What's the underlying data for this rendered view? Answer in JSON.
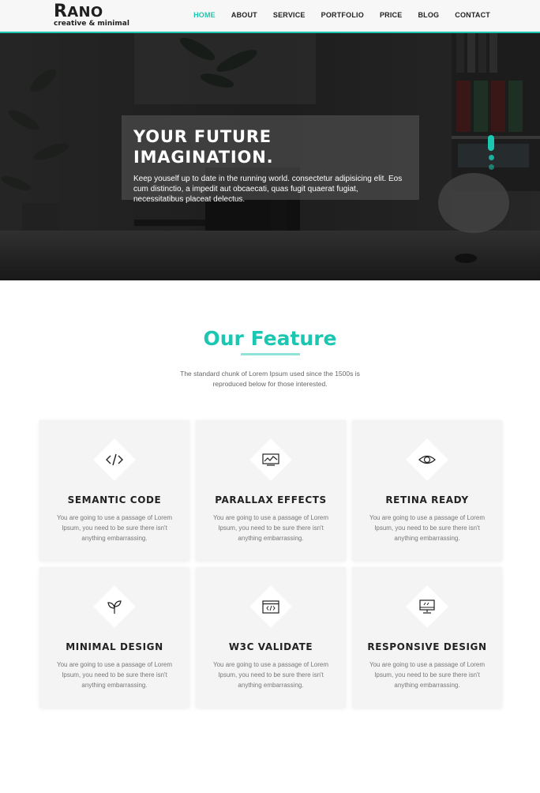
{
  "header": {
    "logo_title_initial": "R",
    "logo_title_rest": "ANO",
    "logo_tagline": "creative & minimal",
    "nav": [
      "HOME",
      "ABOUT",
      "SERVICE",
      "PORTFOLIO",
      "PRICE",
      "BLOG",
      "CONTACT"
    ],
    "active_nav": "HOME"
  },
  "hero": {
    "title": "YOUR FUTURE IMAGINATION.",
    "text": "Keep youself up to date in the running world. consectetur adipisicing elit. Eos cum distinctio, a impedit aut obcaecati, quas fugit quaerat fugiat, necessitatibus placeat delectus.",
    "slides_count": 3,
    "active_slide": 1
  },
  "features": {
    "title": "Our Feature",
    "subtitle": "The standard chunk of Lorem Ipsum used since the 1500s is reproduced below for those interested.",
    "cards": [
      {
        "icon": "code-icon",
        "title": "SEMANTIC CODE",
        "text": "You are going to use a passage of Lorem Ipsum, you need to be sure there isn't anything embarrassing."
      },
      {
        "icon": "chart-monitor-icon",
        "title": "PARALLAX EFFECTS",
        "text": "You are going to use a passage of Lorem Ipsum, you need to be sure there isn't anything embarrassing."
      },
      {
        "icon": "eye-icon",
        "title": "RETINA READY",
        "text": "You are going to use a passage of Lorem Ipsum, you need to be sure there isn't anything embarrassing."
      },
      {
        "icon": "sprout-icon",
        "title": "MINIMAL DESIGN",
        "text": "You are going to use a passage of Lorem Ipsum, you need to be sure there isn't anything embarrassing."
      },
      {
        "icon": "browser-code-icon",
        "title": "W3C VALIDATE",
        "text": "You are going to use a passage of Lorem Ipsum, you need to be sure there isn't anything embarrassing."
      },
      {
        "icon": "desktop-icon",
        "title": "RESPONSIVE DESIGN",
        "text": "You are going to use a passage of Lorem Ipsum, you need to be sure there isn't anything embarrassing."
      }
    ]
  },
  "colors": {
    "accent": "#1bc7b0",
    "card_bg": "#f4f4f4",
    "text_dark": "#222222",
    "text_muted": "#777777"
  }
}
